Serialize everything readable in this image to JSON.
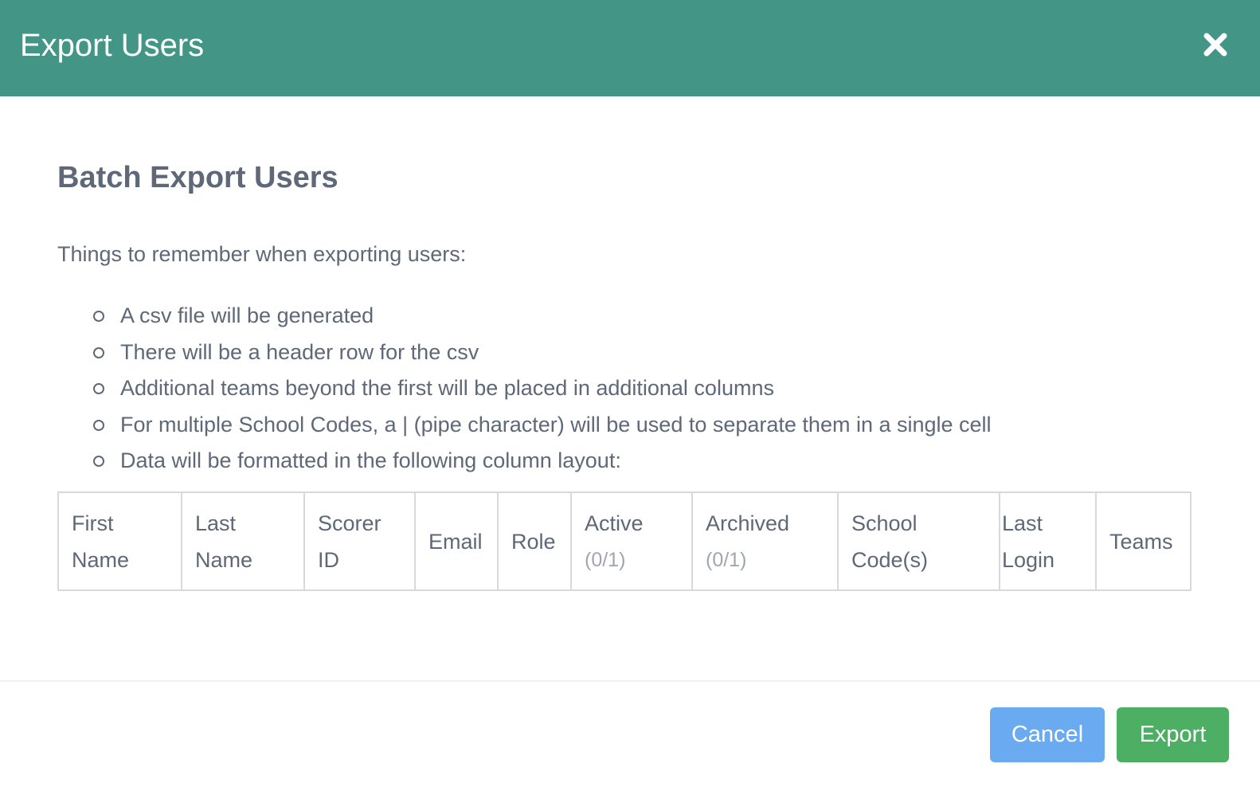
{
  "modal": {
    "title": "Export Users",
    "close_icon": "close-icon",
    "section_title": "Batch Export Users",
    "intro": "Things to remember when exporting users:",
    "rules": [
      "A csv file will be generated",
      "There will be a header row for the csv",
      "Additional teams beyond the first will be placed in additional columns",
      "For multiple School Codes, a | (pipe character) will be used to separate them in a single cell",
      "Data will be formatted in the following column layout:"
    ],
    "columns": [
      {
        "line1": "First",
        "line2": "Name",
        "sub": ""
      },
      {
        "line1": "Last",
        "line2": "Name",
        "sub": ""
      },
      {
        "line1": "Scorer",
        "line2": "ID",
        "sub": ""
      },
      {
        "line1": "Email",
        "line2": "",
        "sub": ""
      },
      {
        "line1": "Role",
        "line2": "",
        "sub": ""
      },
      {
        "line1": "Active",
        "line2": "",
        "sub": "(0/1)"
      },
      {
        "line1": "Archived",
        "line2": "",
        "sub": "(0/1)"
      },
      {
        "line1": "School",
        "line2": "Code(s)",
        "sub": ""
      },
      {
        "line1": "Last",
        "line2": "Login",
        "sub": ""
      },
      {
        "line1": "Teams",
        "line2": "",
        "sub": ""
      }
    ],
    "footer": {
      "cancel_label": "Cancel",
      "export_label": "Export"
    }
  },
  "colors": {
    "header": "#439586",
    "cancel": "#6aaaf0",
    "export": "#4daf63",
    "text": "#5e6878",
    "muted": "#a0a6ae"
  }
}
